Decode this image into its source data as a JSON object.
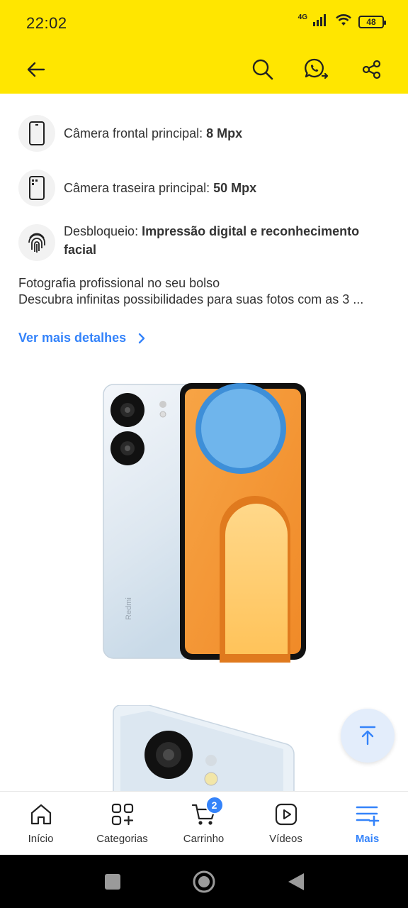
{
  "status": {
    "time": "22:02",
    "network": "4G",
    "battery": "48"
  },
  "specs": [
    {
      "label": "Câmera frontal principal: ",
      "value": "8 Mpx",
      "icon": "phone-front-icon"
    },
    {
      "label": "Câmera traseira principal: ",
      "value": "50 Mpx",
      "icon": "phone-rear-camera-icon"
    },
    {
      "label": "Desbloqueio: ",
      "value": "Impressão digital e reconhecimento facial",
      "icon": "fingerprint-icon"
    }
  ],
  "description": {
    "line1": "Fotografia profissional no seu bolso",
    "line2": "Descubra infinitas possibilidades para suas fotos com as 3 ..."
  },
  "more_details": "Ver mais detalhes",
  "product": {
    "brand_mark": "Redmi"
  },
  "nav": {
    "items": [
      {
        "label": "Início",
        "icon": "home-icon"
      },
      {
        "label": "Categorias",
        "icon": "categories-icon"
      },
      {
        "label": "Carrinho",
        "icon": "cart-icon",
        "badge": "2"
      },
      {
        "label": "Vídeos",
        "icon": "video-icon"
      },
      {
        "label": "Mais",
        "icon": "menu-plus-icon",
        "active": true
      }
    ]
  },
  "colors": {
    "header_bg": "#FFE600",
    "accent": "#3483FA"
  }
}
